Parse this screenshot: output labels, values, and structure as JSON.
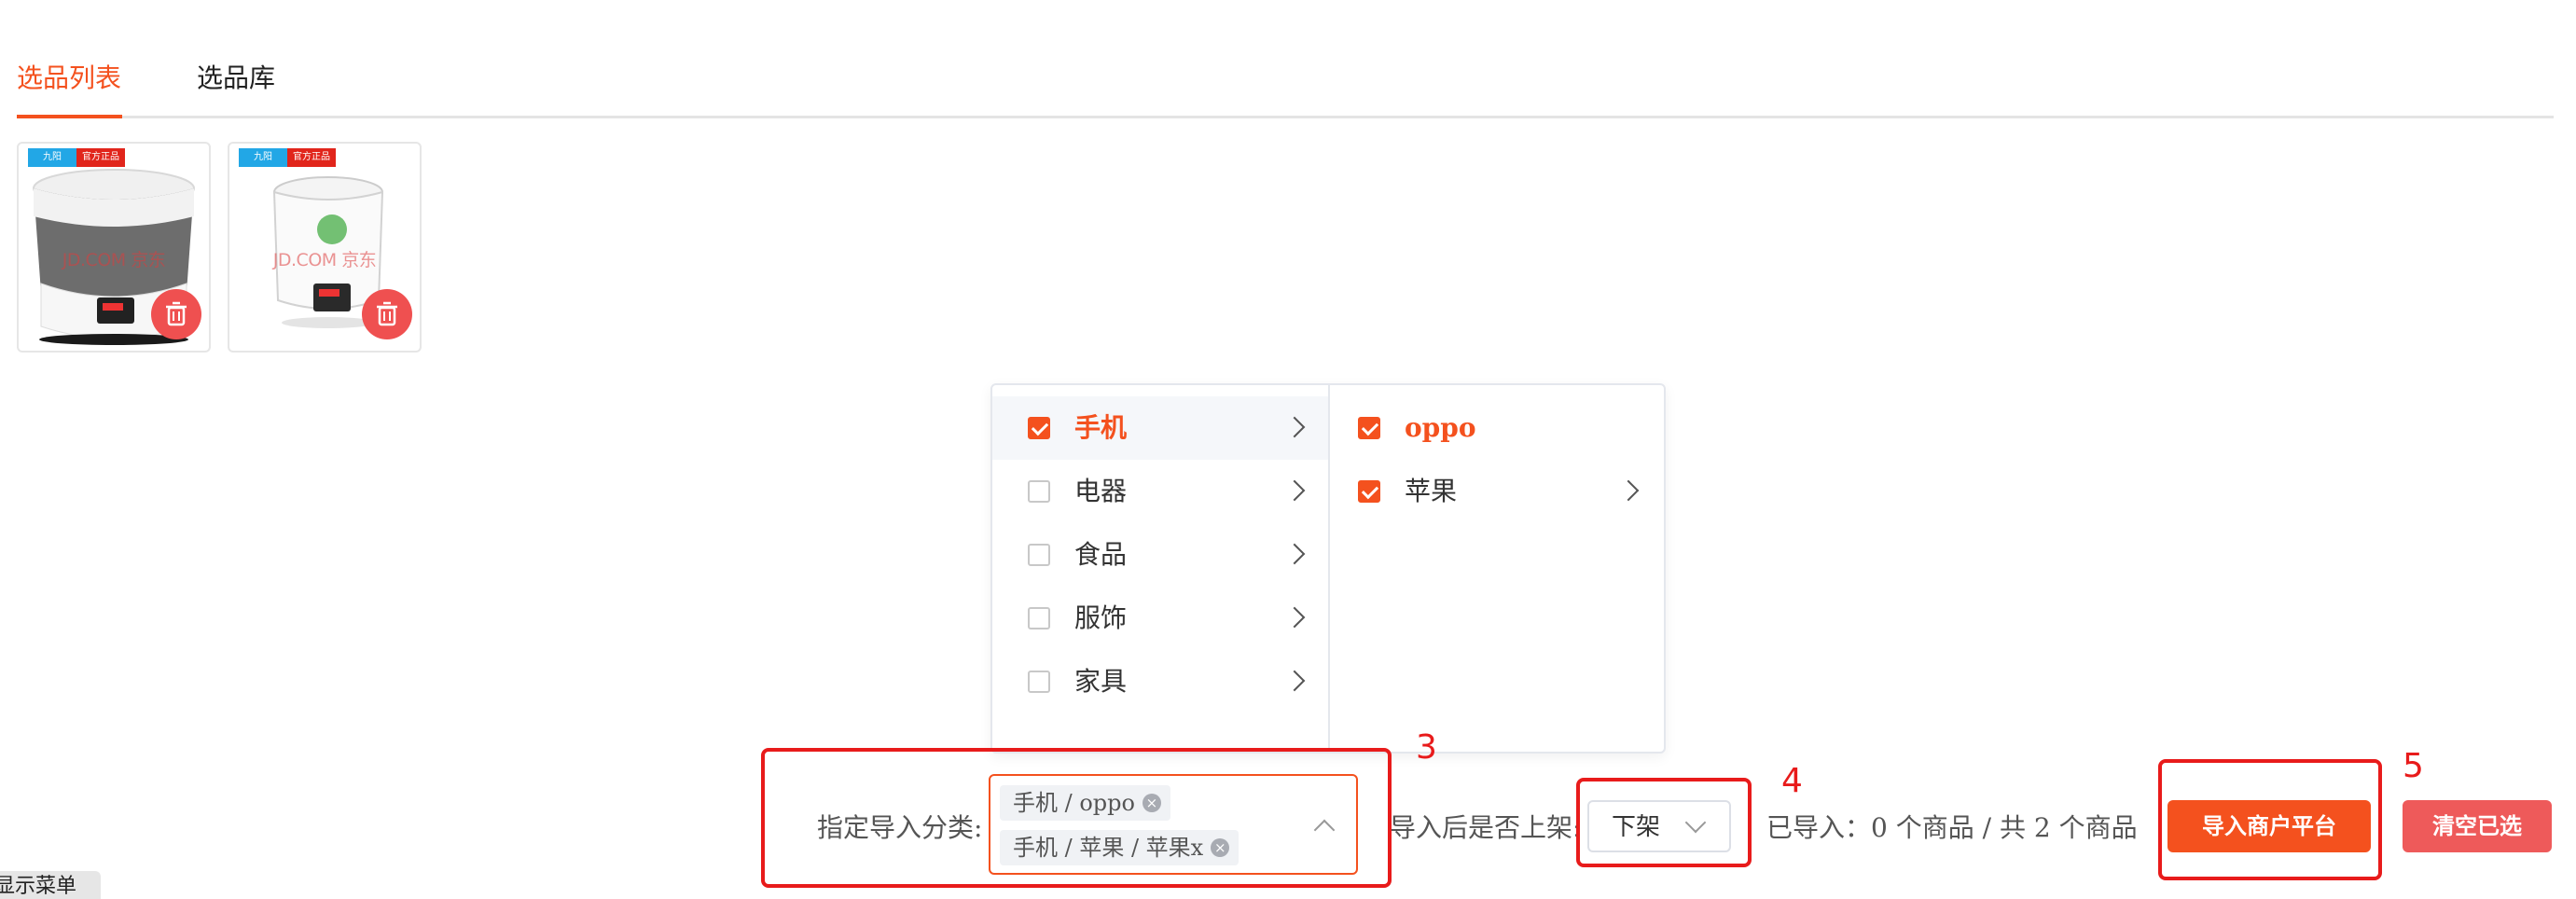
{
  "tabs": [
    {
      "label": "选品列表",
      "active": true
    },
    {
      "label": "选品库",
      "active": false
    }
  ],
  "products": [
    {
      "badge_brand": "九阳",
      "badge_official": "官方正品",
      "watermark": "JD.COM 京东"
    },
    {
      "badge_brand": "九阳",
      "badge_official": "官方正品",
      "watermark": "JD.COM 京东"
    }
  ],
  "cascader": {
    "level1": [
      {
        "label": "手机",
        "checked": true,
        "active": true
      },
      {
        "label": "电器",
        "checked": false,
        "active": false
      },
      {
        "label": "食品",
        "checked": false,
        "active": false
      },
      {
        "label": "服饰",
        "checked": false,
        "active": false
      },
      {
        "label": "家具",
        "checked": false,
        "active": false
      }
    ],
    "level2": [
      {
        "label": "oppo",
        "checked": true,
        "has_children": false
      },
      {
        "label": "苹果",
        "checked": true,
        "has_children": true
      }
    ]
  },
  "form": {
    "category_label": "指定导入分类:",
    "tags": [
      "手机 / oppo",
      "手机 / 苹果 / 苹果x"
    ],
    "shelf_label": "导入后是否上架:",
    "shelf_value": "下架",
    "imported_text": "已导入：0 个商品 / 共 2 个商品"
  },
  "buttons": {
    "import": "导入商户平台",
    "clear": "清空已选"
  },
  "annotations": {
    "box3": "3",
    "box4": "4",
    "box5": "5"
  },
  "menu_toggle": "显示菜单",
  "colors": {
    "accent": "#f4511e",
    "danger": "#ee5a5a",
    "annotation": "#e81b1b"
  }
}
